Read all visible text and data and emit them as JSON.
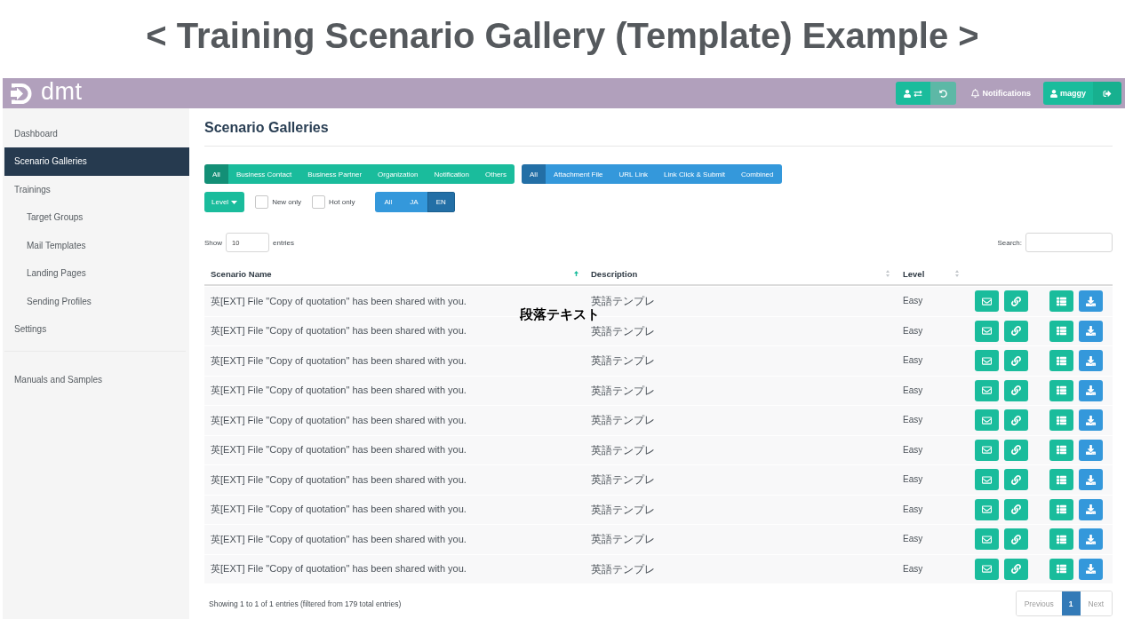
{
  "slide_title": "< Training Scenario Gallery (Template) Example >",
  "header": {
    "logo": "dmt",
    "notifications": "Notifications",
    "user_name": "maggy"
  },
  "sidebar": {
    "groups": [
      {
        "items": [
          {
            "label": "Dashboard",
            "selected": false
          },
          {
            "label": "Scenario Galleries",
            "selected": true
          },
          {
            "label": "Trainings",
            "selected": false,
            "children": [
              {
                "label": "Target Groups",
                "selected": false
              },
              {
                "label": "Mail Templates",
                "selected": false
              },
              {
                "label": "Landing Pages",
                "selected": false
              },
              {
                "label": "Sending Profiles",
                "selected": false
              }
            ]
          },
          {
            "label": "Settings",
            "selected": false
          }
        ]
      },
      {
        "items": [
          {
            "label": "Manuals and Samples",
            "selected": false
          }
        ]
      }
    ]
  },
  "page": {
    "heading": "Scenario Galleries"
  },
  "filters": {
    "categories": [
      {
        "label": "All",
        "selected": true
      },
      {
        "label": "Business Contact",
        "selected": false
      },
      {
        "label": "Business Partner",
        "selected": false
      },
      {
        "label": "Organization",
        "selected": false
      },
      {
        "label": "Notification",
        "selected": false
      },
      {
        "label": "Others",
        "selected": false
      }
    ],
    "types": [
      {
        "label": "All",
        "selected": true
      },
      {
        "label": "Attachment File",
        "selected": false
      },
      {
        "label": "URL Link",
        "selected": false
      },
      {
        "label": "Link Click & Submit",
        "selected": false
      },
      {
        "label": "Combined",
        "selected": false
      }
    ],
    "level_menu": "Level",
    "checkboxes": [
      {
        "label": "New only",
        "checked": false
      },
      {
        "label": "Hot only",
        "checked": false
      }
    ],
    "languages": [
      {
        "label": "All",
        "selected": false
      },
      {
        "label": "JA",
        "selected": false
      },
      {
        "label": "EN",
        "selected": true
      }
    ]
  },
  "table": {
    "show_label": "Show",
    "page_length": "10",
    "entries_label": "entries",
    "search_label": "Search:",
    "columns": [
      {
        "label": "Scenario Name",
        "sorted": true
      },
      {
        "label": "Description",
        "sorted": false
      },
      {
        "label": "Level",
        "sorted": false
      }
    ],
    "rows": [
      {
        "name": "英[EXT] File \"Copy of quotation\" has been shared with you.",
        "description": "英語テンプレ",
        "level": "Easy"
      },
      {
        "name": "英[EXT] File \"Copy of quotation\" has been shared with you.",
        "description": "英語テンプレ",
        "level": "Easy"
      },
      {
        "name": "英[EXT] File \"Copy of quotation\" has been shared with you.",
        "description": "英語テンプレ",
        "level": "Easy"
      },
      {
        "name": "英[EXT] File \"Copy of quotation\" has been shared with you.",
        "description": "英語テンプレ",
        "level": "Easy"
      },
      {
        "name": "英[EXT] File \"Copy of quotation\" has been shared with you.",
        "description": "英語テンプレ",
        "level": "Easy"
      },
      {
        "name": "英[EXT] File \"Copy of quotation\" has been shared with you.",
        "description": "英語テンプレ",
        "level": "Easy"
      },
      {
        "name": "英[EXT] File \"Copy of quotation\" has been shared with you.",
        "description": "英語テンプレ",
        "level": "Easy"
      },
      {
        "name": "英[EXT] File \"Copy of quotation\" has been shared with you.",
        "description": "英語テンプレ",
        "level": "Easy"
      },
      {
        "name": "英[EXT] File \"Copy of quotation\" has been shared with you.",
        "description": "英語テンプレ",
        "level": "Easy"
      },
      {
        "name": "英[EXT] File \"Copy of quotation\" has been shared with you.",
        "description": "英語テンプレ",
        "level": "Easy"
      }
    ],
    "info": "Showing 1 to 1 of 1 entries (filtered from 179 total entries)",
    "pagination": [
      {
        "label": "Previous",
        "selected": false,
        "disabled": true
      },
      {
        "label": "1",
        "selected": true,
        "disabled": false
      },
      {
        "label": "Next",
        "selected": false,
        "disabled": true
      }
    ]
  },
  "annotation": "段落テキスト"
}
